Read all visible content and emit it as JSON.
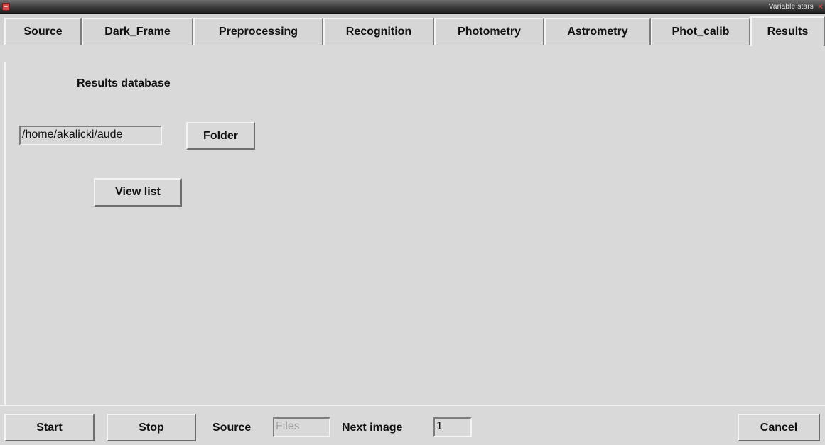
{
  "window": {
    "title": "Variable stars"
  },
  "tabs": [
    {
      "label": "Source"
    },
    {
      "label": "Dark_Frame"
    },
    {
      "label": "Preprocessing"
    },
    {
      "label": "Recognition"
    },
    {
      "label": "Photometry"
    },
    {
      "label": "Astrometry"
    },
    {
      "label": "Phot_calib"
    },
    {
      "label": "Results"
    }
  ],
  "active_tab": "Results",
  "results": {
    "heading": "Results database",
    "folder_path": "/home/akalicki/aude",
    "folder_button": "Folder",
    "view_list_button": "View list"
  },
  "bottom": {
    "start_button": "Start",
    "stop_button": "Stop",
    "source_label": "Source",
    "source_value": "Files",
    "next_image_label": "Next image",
    "next_image_value": "1",
    "cancel_button": "Cancel"
  },
  "colors": {
    "background": "#d9d9d9",
    "disabled_text": "#a4a4a4",
    "close_icon": "#cc4444"
  }
}
